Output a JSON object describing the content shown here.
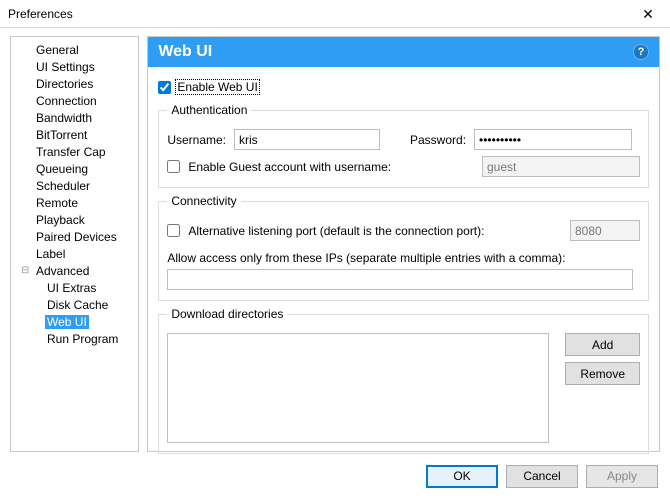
{
  "window": {
    "title": "Preferences",
    "close": "✕"
  },
  "tree": {
    "expander": "⊟",
    "items": [
      "General",
      "UI Settings",
      "Directories",
      "Connection",
      "Bandwidth",
      "BitTorrent",
      "Transfer Cap",
      "Queueing",
      "Scheduler",
      "Remote",
      "Playback",
      "Paired Devices",
      "Label",
      "Advanced"
    ],
    "children": [
      "UI Extras",
      "Disk Cache",
      "Web UI",
      "Run Program"
    ],
    "selected": "Web UI"
  },
  "panel": {
    "heading": "Web UI",
    "help": "?",
    "enable_label": "Enable Web UI",
    "enable_checked": true
  },
  "auth": {
    "legend": "Authentication",
    "username_label": "Username:",
    "username_value": "kris",
    "password_label": "Password:",
    "password_value": "••••••••••",
    "guest_label": "Enable Guest account with username:",
    "guest_checked": false,
    "guest_value": "guest"
  },
  "conn": {
    "legend": "Connectivity",
    "altport_label": "Alternative listening port (default is the connection port):",
    "altport_checked": false,
    "altport_value": "8080",
    "restrict_label": "Allow access only from these IPs (separate multiple entries with a comma):",
    "restrict_value": ""
  },
  "dl": {
    "legend": "Download directories",
    "add": "Add",
    "remove": "Remove"
  },
  "footer": {
    "ok": "OK",
    "cancel": "Cancel",
    "apply": "Apply"
  }
}
